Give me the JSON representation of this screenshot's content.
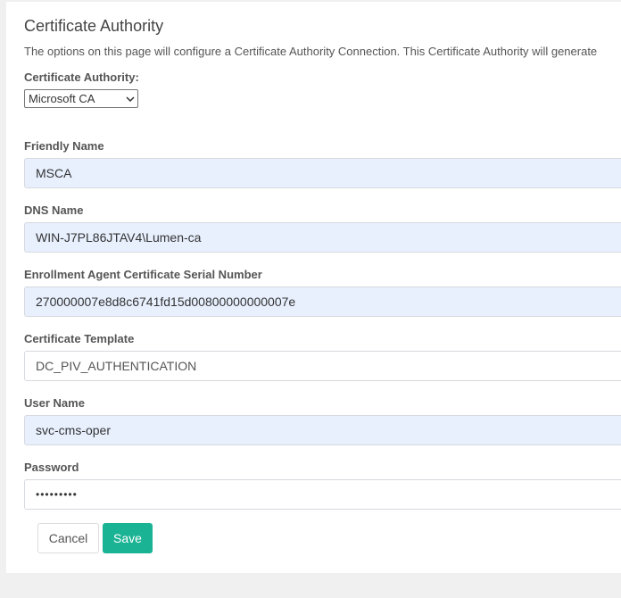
{
  "page": {
    "title": "Certificate Authority",
    "description": "The options on this page will configure a Certificate Authority Connection. This Certificate Authority will generate"
  },
  "ca_selector": {
    "label": "Certificate Authority:",
    "selected": "Microsoft CA"
  },
  "fields": {
    "friendly_name": {
      "label": "Friendly Name",
      "value": "MSCA"
    },
    "dns_name": {
      "label": "DNS Name",
      "value": "WIN-J7PL86JTAV4\\Lumen-ca"
    },
    "serial_number": {
      "label": "Enrollment Agent Certificate Serial Number",
      "value": "270000007e8d8c6741fd15d00800000000007e"
    },
    "template": {
      "label": "Certificate Template",
      "value": "DC_PIV_AUTHENTICATION"
    },
    "user_name": {
      "label": "User Name",
      "value": "svc-cms-oper"
    },
    "password": {
      "label": "Password",
      "value": "•••••••••"
    }
  },
  "actions": {
    "cancel_label": "Cancel",
    "save_label": "Save"
  },
  "colors": {
    "accent": "#1ab394",
    "autofill_bg": "#e8f0fe"
  },
  "icons": {
    "select_chevron": "chevron-down-icon"
  }
}
